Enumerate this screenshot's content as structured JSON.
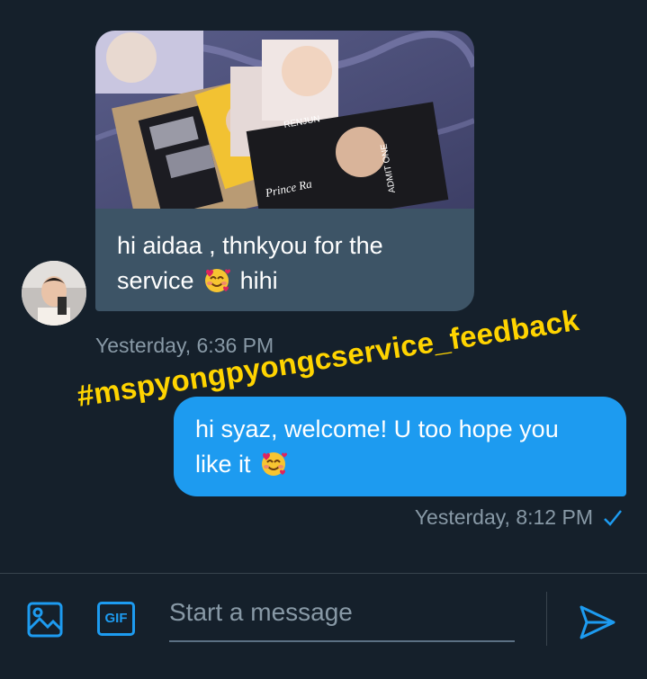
{
  "conversation": {
    "incoming": {
      "text_line1": "hi aidaa , thnkyou for the",
      "text_line2_a": "service",
      "text_line2_b": "hihi",
      "timestamp": "Yesterday, 6:36 PM"
    },
    "outgoing": {
      "text_line1": "hi syaz, welcome! U too hope you",
      "text_line2": "like it",
      "timestamp": "Yesterday, 8:12 PM"
    }
  },
  "overlay": {
    "hashtag": "#mspyongpyongcservice_feedback"
  },
  "photo": {
    "labels": [
      "RENJUN",
      "ADMIT ONE",
      "Prince Ra"
    ]
  },
  "composer": {
    "gif_label": "GIF",
    "placeholder": "Start a message"
  },
  "icons": [
    "image-icon",
    "gif-icon",
    "send-icon",
    "read-check-icon",
    "smiling-hearts-emoji"
  ],
  "colors": {
    "background": "#15202b",
    "incoming_bubble": "#3d5466",
    "outgoing_bubble": "#1d9bf0",
    "muted_text": "#8899a6",
    "hashtag": "#ffd400"
  }
}
